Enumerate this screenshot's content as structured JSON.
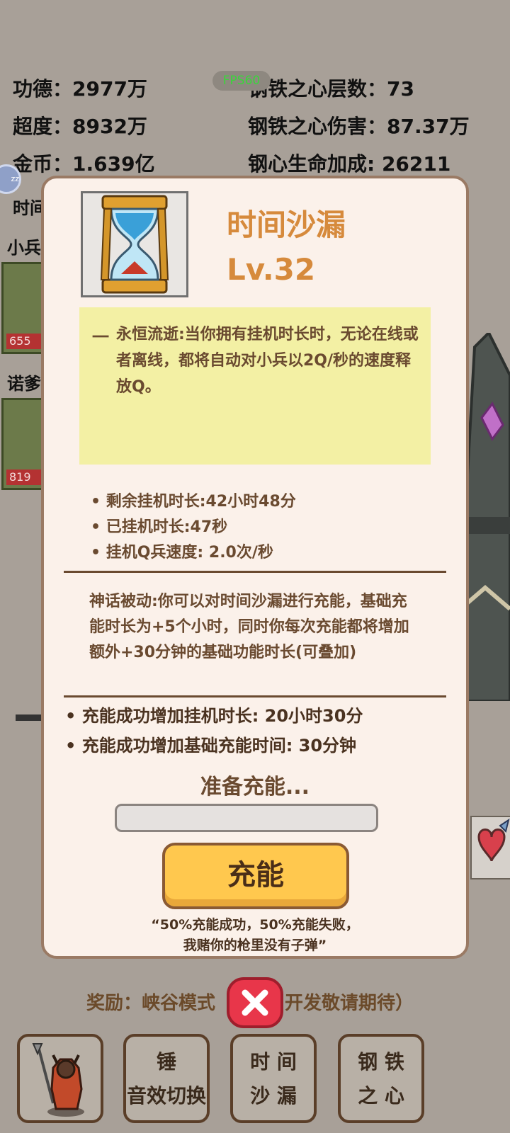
{
  "header_stats": {
    "merit": "功德：2977万",
    "transcend": "超度：8932万",
    "gold": "金币：1.639亿",
    "iron_heart_layers": "钢铁之心层数：73",
    "iron_heart_damage": "钢铁之心伤害：87.37万",
    "iron_heart_hp_bonus": "钢心生命加成: 26211",
    "fps": "FPS60"
  },
  "background": {
    "label_time": "时间",
    "label_minion": "小兵",
    "label_nuo": "诺爹",
    "portrait1_value": "655",
    "portrait2_value": "819",
    "reward_left": "奖励：峡谷模式",
    "reward_right": "开发敬请期待）",
    "zz_badge": "zz"
  },
  "bottom_tabs": {
    "hammer_line1": "锤",
    "hammer_line2": "音效切换",
    "sand_line1": "时 间",
    "sand_line2": "沙 漏",
    "heart_line1": "钢 铁",
    "heart_line2": "之 心"
  },
  "dialog": {
    "item_name": "时间沙漏",
    "item_level": "Lv.32",
    "skill_dash": "一",
    "skill_desc": "永恒流逝:当你拥有挂机时长时，无论在线或者离线，都将自动对小兵以2Q/秒的速度释放Q。",
    "stats": [
      "剩余挂机时长:42小时48分",
      "已挂机时长:47秒",
      "挂机Q兵速度: 2.0次/秒"
    ],
    "myth_passive": "神话被动:你可以对时间沙漏进行充能，基础充能时长为+5个小时，同时你每次充能都将增加额外+30分钟的基础功能时长(可叠加)",
    "charge_bonuses": [
      "充能成功增加挂机时长: 20小时30分",
      "充能成功增加基础充能时间: 30分钟"
    ],
    "ready_text": "准备充能...",
    "charge_progress": 0,
    "charge_button": "充能",
    "quote_line1": "“50%充能成功，50%充能失败，",
    "quote_line2": "我赌你的枪里没有子弹”"
  },
  "colors": {
    "panel_bg": "#fbf1ea",
    "title_orange": "#d68a3c",
    "yellow_box": "#f3f0a4",
    "button_yellow": "#ffc84e",
    "close_red": "#e8364a"
  },
  "icons": {
    "item": "hourglass-icon",
    "close": "close-x-icon",
    "hero_tab": "demon-warrior-icon"
  }
}
